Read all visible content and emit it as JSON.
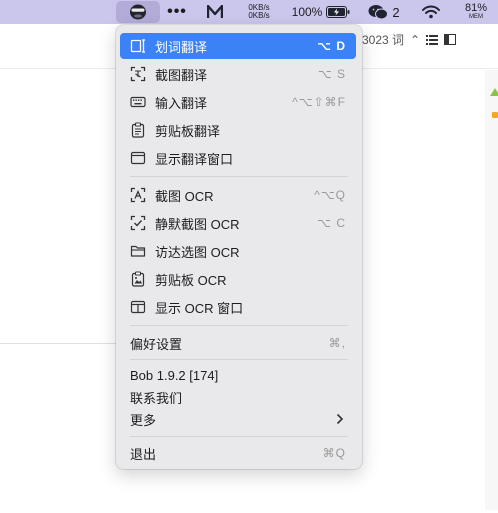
{
  "menubar": {
    "net_up": "0KB/s",
    "net_down": "0KB/s",
    "battery": "100%",
    "wechat_count": "2",
    "mem_percent": "81%",
    "mem_label": "MEM",
    "bar_color": "#cbc6ec"
  },
  "background": {
    "word_count": "3023 词"
  },
  "menu": {
    "accent": "#3b82f6",
    "groups": [
      [
        {
          "label": "划词翻译",
          "shortcut": "⌥ D",
          "icon": "selection-translate-icon"
        },
        {
          "label": "截图翻译",
          "shortcut": "⌥ S",
          "icon": "screenshot-translate-icon"
        },
        {
          "label": "输入翻译",
          "shortcut": "^⌥⇧⌘F",
          "icon": "keyboard-icon"
        },
        {
          "label": "剪贴板翻译",
          "shortcut": "",
          "icon": "clipboard-icon"
        },
        {
          "label": "显示翻译窗口",
          "shortcut": "",
          "icon": "window-icon"
        }
      ],
      [
        {
          "label": "截图 OCR",
          "shortcut": "^⌥Q",
          "icon": "screenshot-ocr-icon"
        },
        {
          "label": "静默截图 OCR",
          "shortcut": "⌥ C",
          "icon": "silent-ocr-icon"
        },
        {
          "label": "访达选图 OCR",
          "shortcut": "",
          "icon": "folder-icon"
        },
        {
          "label": "剪贴板 OCR",
          "shortcut": "",
          "icon": "clipboard-image-icon"
        },
        {
          "label": "显示 OCR 窗口",
          "shortcut": "",
          "icon": "ocr-window-icon"
        }
      ]
    ],
    "preferences": {
      "label": "偏好设置",
      "shortcut": "⌘,"
    },
    "version": "Bob 1.9.2 [174]",
    "contact": "联系我们",
    "more": "更多",
    "quit": {
      "label": "退出",
      "shortcut": "⌘Q"
    }
  }
}
